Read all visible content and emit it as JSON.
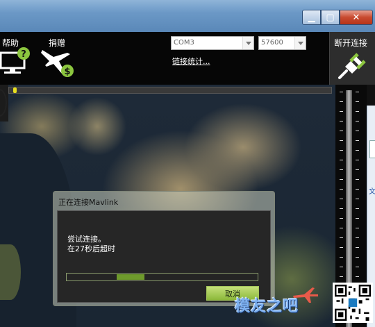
{
  "toolbar": {
    "help_label": "帮助",
    "donate_label": "捐赠",
    "port": "COM3",
    "baud": "57600",
    "link_stats": "链接统计...",
    "disconnect_label": "断开连接"
  },
  "right_strip": {
    "text": "文"
  },
  "dialog": {
    "title": "正在连接Mavlink",
    "status": "尝试连接。\n在27秒后超时",
    "cancel": "取消",
    "progress": 0.26
  },
  "watermark": {
    "text": "模友之吧"
  },
  "colors": {
    "progress": "#6e9a2c",
    "accent": "#8cb83a"
  }
}
